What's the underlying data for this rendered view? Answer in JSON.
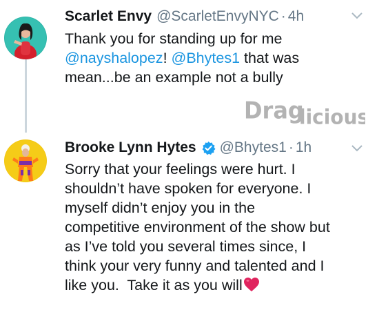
{
  "tweets": [
    {
      "display_name": "Scarlet Envy",
      "handle": "@ScarletEnvyNYC",
      "separator": "·",
      "time": "4h",
      "lines": [
        [
          {
            "t": "Thank you for standing up for me",
            "m": false
          }
        ],
        [
          {
            "t": "@nayshalopez",
            "m": true
          },
          {
            "t": "! ",
            "m": false
          },
          {
            "t": "@Bhytes1",
            "m": true
          },
          {
            "t": " that was",
            "m": false
          }
        ],
        [
          {
            "t": "mean...be an example not a bully",
            "m": false
          }
        ]
      ]
    },
    {
      "display_name": "Brooke Lynn Hytes",
      "handle": "@Bhytes1",
      "separator": "·",
      "time": "1h",
      "verified": true,
      "lines": [
        [
          {
            "t": "Sorry that your feelings were hurt. I",
            "m": false
          }
        ],
        [
          {
            "t": "shouldn’t have spoken for everyone. I",
            "m": false
          }
        ],
        [
          {
            "t": "myself didn’t enjoy you in the",
            "m": false
          }
        ],
        [
          {
            "t": "competitive environment of the show but",
            "m": false
          }
        ],
        [
          {
            "t": "as I’ve told you several times since, I",
            "m": false
          }
        ],
        [
          {
            "t": "think your very funny and talented and I",
            "m": false
          }
        ],
        [
          {
            "t": "like you.  Take it as you will",
            "m": false
          }
        ]
      ],
      "emoji": "heart"
    }
  ],
  "watermark": "Draglicious",
  "colors": {
    "text": "#14171a",
    "muted": "#657786",
    "mention": "#1b95e0",
    "verified": "#1da1f2",
    "thread_line": "#ccd6dd",
    "heart": "#e0245e"
  }
}
